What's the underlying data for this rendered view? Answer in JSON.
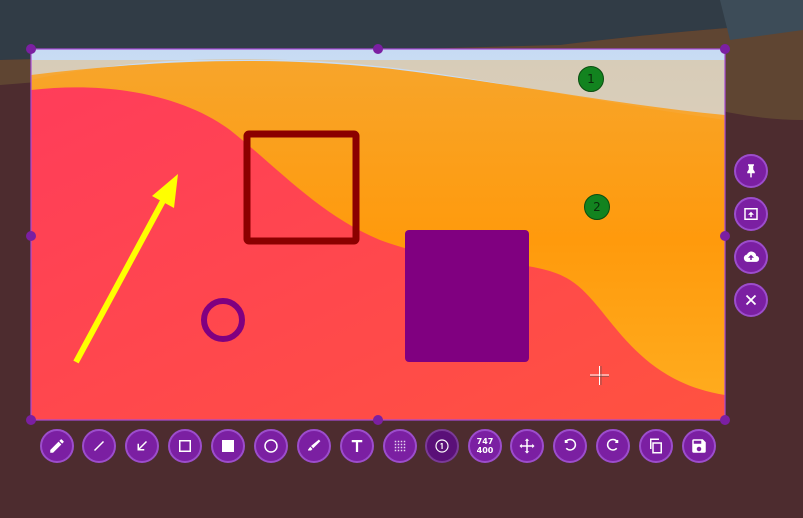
{
  "screenshot": {
    "colors": {
      "accent": "#7b1fa2",
      "selection_border": "#a64ad6",
      "handle": "#7b1fa2",
      "arrow": "#ffff00",
      "rect_outline": "#8b0000",
      "filled_rect": "#800080",
      "ellipse": "#800080",
      "badge": "#12831f"
    },
    "step_badges": [
      "1",
      "2"
    ],
    "side_toolbar": {
      "items": [
        {
          "name": "pin",
          "icon": "pin-icon"
        },
        {
          "name": "open-in-window",
          "icon": "open-window-icon"
        },
        {
          "name": "upload",
          "icon": "cloud-upload-icon"
        },
        {
          "name": "close",
          "icon": "close-icon"
        }
      ]
    },
    "bottom_toolbar": {
      "items": [
        {
          "name": "pencil",
          "icon": "pencil-icon"
        },
        {
          "name": "line",
          "icon": "line-icon"
        },
        {
          "name": "arrow",
          "icon": "arrow-icon"
        },
        {
          "name": "rectangle",
          "icon": "rectangle-icon"
        },
        {
          "name": "filled-rectangle",
          "icon": "filled-rectangle-icon"
        },
        {
          "name": "circle",
          "icon": "circle-icon"
        },
        {
          "name": "marker",
          "icon": "marker-icon"
        },
        {
          "name": "text",
          "icon": "text-icon"
        },
        {
          "name": "pixelate",
          "icon": "pixelate-icon"
        },
        {
          "name": "circle-count",
          "icon": "circle-count-icon"
        },
        {
          "name": "selection-size",
          "icon": "size-indicator",
          "width": "747",
          "height": "400"
        },
        {
          "name": "move",
          "icon": "move-icon"
        },
        {
          "name": "undo",
          "icon": "undo-icon"
        },
        {
          "name": "redo",
          "icon": "redo-icon"
        },
        {
          "name": "copy",
          "icon": "copy-icon"
        },
        {
          "name": "save",
          "icon": "save-icon"
        }
      ]
    }
  }
}
